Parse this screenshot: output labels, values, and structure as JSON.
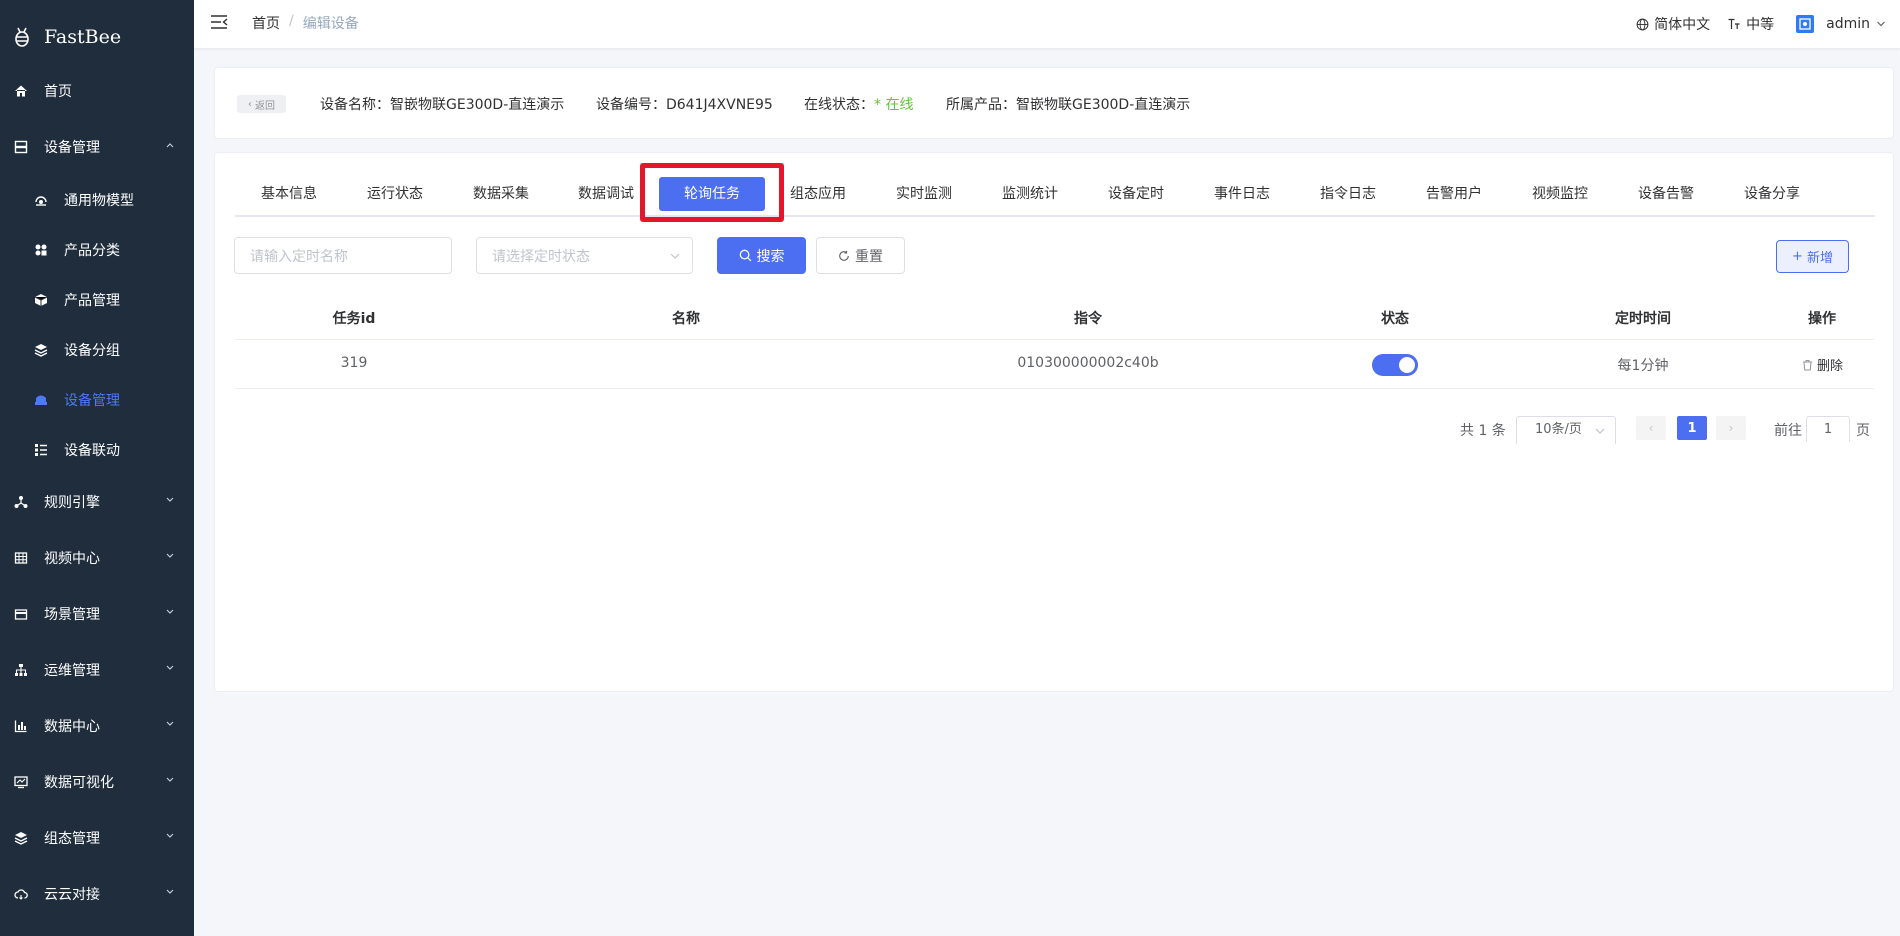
{
  "app": {
    "name": "FastBee"
  },
  "sidebar": {
    "items": [
      {
        "label": "首页",
        "icon": "home-icon"
      },
      {
        "label": "设备管理",
        "icon": "server-icon",
        "expanded": true
      },
      {
        "label": "规则引擎",
        "icon": "nodes-icon"
      },
      {
        "label": "视频中心",
        "icon": "table-icon"
      },
      {
        "label": "场景管理",
        "icon": "wallet-icon"
      },
      {
        "label": "运维管理",
        "icon": "tree-icon"
      },
      {
        "label": "数据中心",
        "icon": "chart-icon"
      },
      {
        "label": "数据可视化",
        "icon": "screen-icon"
      },
      {
        "label": "组态管理",
        "icon": "layers-icon"
      },
      {
        "label": "云云对接",
        "icon": "cloud-icon"
      }
    ],
    "sub_items": [
      {
        "label": "通用物模型",
        "icon": "cpu-icon"
      },
      {
        "label": "产品分类",
        "icon": "category-icon"
      },
      {
        "label": "产品管理",
        "icon": "box-icon"
      },
      {
        "label": "设备分组",
        "icon": "layers-icon"
      },
      {
        "label": "设备管理",
        "icon": "monitor-icon",
        "active": true
      },
      {
        "label": "设备联动",
        "icon": "list-icon"
      }
    ]
  },
  "navbar": {
    "breadcrumb": {
      "home": "首页",
      "separator": "/",
      "current": "编辑设备"
    },
    "language": "简体中文",
    "size": "中等",
    "user": "admin"
  },
  "device_info": {
    "back": "返回",
    "name": "设备名称：智嵌物联GE300D-直连演示",
    "serial": "设备编号：D641J4XVNE95",
    "status_label": "在线状态：",
    "status_value": "* 在线",
    "product": "所属产品：智嵌物联GE300D-直连演示"
  },
  "tabs": [
    "基本信息",
    "运行状态",
    "数据采集",
    "数据调试",
    "轮询任务",
    "组态应用",
    "实时监测",
    "监测统计",
    "设备定时",
    "事件日志",
    "指令日志",
    "告警用户",
    "视频监控",
    "设备告警",
    "设备分享"
  ],
  "active_tab": "轮询任务",
  "filters": {
    "name_placeholder": "请输入定时名称",
    "status_placeholder": "请选择定时状态",
    "search": "搜索",
    "reset": "重置",
    "add": "新增"
  },
  "table": {
    "headers": [
      "任务id",
      "名称",
      "指令",
      "状态",
      "定时时间",
      "操作"
    ],
    "rows": [
      {
        "id": "319",
        "name": "",
        "command": "010300000002c40b",
        "enabled": true,
        "schedule": "每1分钟",
        "action": "删除"
      }
    ]
  },
  "pagination": {
    "total": "共 1 条",
    "page_size": "10条/页",
    "current": "1",
    "goto_label": "前往",
    "goto_value": "1",
    "page_suffix": "页"
  },
  "colors": {
    "sidebar_bg": "#1f2d3d",
    "primary": "#4b6ff0",
    "online": "#67c23a",
    "highlight": "#e5162a"
  }
}
